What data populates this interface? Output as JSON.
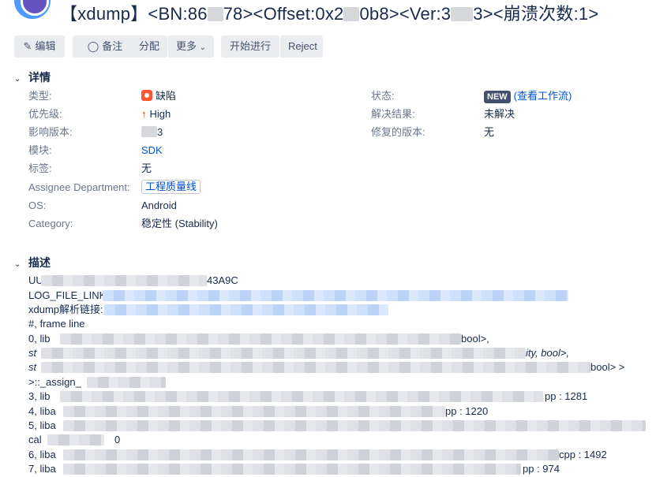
{
  "header": {
    "title_part1": "【xdump】<BN:86",
    "title_part2": "78><Offset:0x2",
    "title_part3": "0b8><Ver:3",
    "title_part4": "3><崩溃次数:1>"
  },
  "toolbar": {
    "edit": "编辑",
    "comment": "备注",
    "assign": "分配",
    "more": "更多",
    "start": "开始进行",
    "reject": "Reject"
  },
  "details": {
    "section_title": "详情",
    "type_label": "类型:",
    "type_value": "缺陷",
    "priority_label": "优先级:",
    "priority_value": "High",
    "affects_label": "影响版本:",
    "affects_value": "3",
    "component_label": "模块:",
    "component_value": "SDK",
    "labels_label": "标签:",
    "labels_value": "无",
    "assignee_dept_label": "Assignee Department:",
    "assignee_dept_value": "工程质量线",
    "os_label": "OS:",
    "os_value": "Android",
    "category_label": "Category:",
    "category_value": "稳定性 (Stability)",
    "status_label": "状态:",
    "status_badge": "NEW",
    "status_link": "(查看工作流)",
    "resolution_label": "解决结果:",
    "resolution_value": "未解决",
    "fix_label": "修复的版本:",
    "fix_value": "无"
  },
  "description": {
    "section_title": "描述",
    "line1_a": "UU",
    "line1_b": "43A9C",
    "line2": "LOG_FILE_LINK",
    "line3": "xdump解析链接:",
    "line4": "#, frame line",
    "line5_a": "0, lib",
    "line5_b": "bool>,",
    "line6_a": "st",
    "line6_b": "ity, bool>,",
    "line7_a": "st",
    "line7_b": "bool> >",
    "line8": ">::_assign_",
    "line9_a": "3, lib",
    "line9_b": "pp : 1281",
    "line10_a": "4, liba",
    "line10_b": "pp : 1220",
    "line11": "5, liba",
    "line12_a": "cal",
    "line12_b": "0",
    "line13_a": "6, liba",
    "line13_b": "cpp : 1492",
    "line14_a": "7, liba",
    "line14_b": "pp : 974"
  }
}
